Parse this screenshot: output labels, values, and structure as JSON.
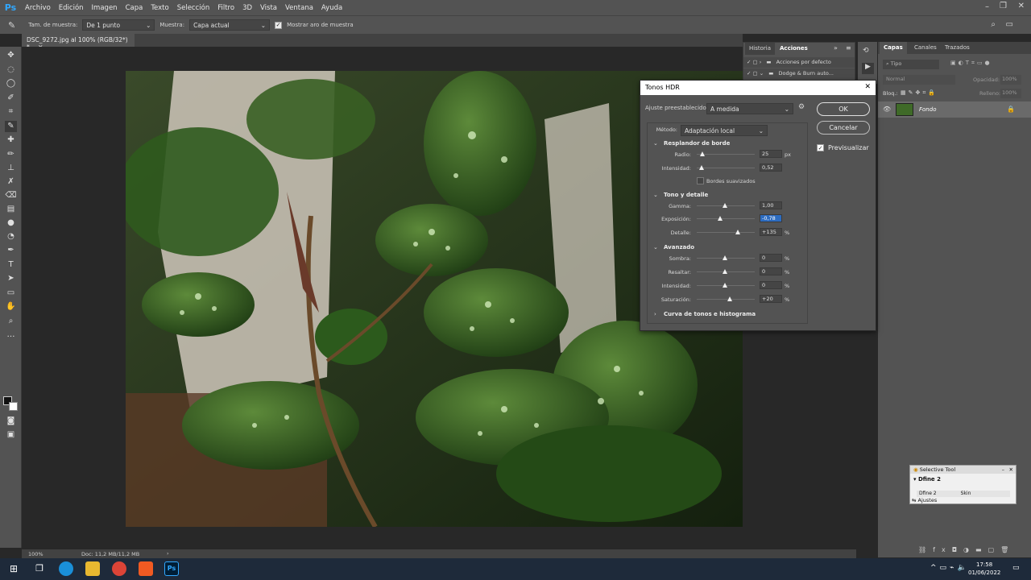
{
  "menubar": {
    "logo": "Ps",
    "items": [
      "Archivo",
      "Edición",
      "Imagen",
      "Capa",
      "Texto",
      "Selección",
      "Filtro",
      "3D",
      "Vista",
      "Ventana",
      "Ayuda"
    ]
  },
  "options": {
    "sample_size_label": "Tam. de muestra:",
    "sample_size_value": "De 1 punto",
    "sample_label": "Muestra:",
    "sample_value": "Capa actual",
    "show_ring_label": "Mostrar aro de muestra"
  },
  "document": {
    "tab_title": "DSC_9272.jpg al 100% (RGB/32*) *",
    "zoom": "100%",
    "doc_info": "Doc: 11,2 MB/11,2 MB"
  },
  "actions_panel": {
    "tabs": [
      "Historia",
      "Acciones"
    ],
    "items": [
      "Acciones por defecto",
      "Dodge & Burn auto..."
    ]
  },
  "layers_panel": {
    "tabs": [
      "Capas",
      "Canales",
      "Trazados"
    ],
    "kind_placeholder": "Tipo",
    "blend_mode": "Normal",
    "opacity_label": "Opacidad:",
    "opacity_value": "100%",
    "lock_label": "Bloq.:",
    "fill_label": "Relleno:",
    "fill_value": "100%",
    "layer_name": "Fondo"
  },
  "hdr_dialog": {
    "title": "Tonos HDR",
    "preset_label": "Ajuste preestablecido:",
    "preset_value": "A medida",
    "method_label": "Método:",
    "method_value": "Adaptación local",
    "ok_label": "OK",
    "cancel_label": "Cancelar",
    "preview_label": "Previsualizar",
    "sections": {
      "edge_glow": "Resplandor de borde",
      "tone_detail": "Tono y detalle",
      "advanced": "Avanzado",
      "curve": "Curva de tonos e histograma"
    },
    "radius_label": "Radio:",
    "radius_value": "25",
    "radius_unit": "px",
    "radius_pos": 0.06,
    "strength_label": "Intensidad:",
    "strength_value": "0,52",
    "strength_pos": 0.05,
    "smooth_edges_label": "Bordes suavizados",
    "gamma_label": "Gamma:",
    "gamma_value": "1,00",
    "gamma_pos": 0.5,
    "exposure_label": "Exposición:",
    "exposure_value": "-0,78",
    "exposure_pos": 0.4,
    "detail_label": "Detalle:",
    "detail_value": "+135",
    "detail_unit": "%",
    "detail_pos": 0.72,
    "shadow_label": "Sombra:",
    "shadow_value": "0",
    "shadow_pos": 0.5,
    "highlight_label": "Resaltar:",
    "highlight_value": "0",
    "highlight_pos": 0.5,
    "vibrance_label": "Intensidad:",
    "vibrance_value": "0",
    "vibrance_pos": 0.5,
    "saturation_label": "Saturación:",
    "saturation_value": "+20",
    "saturation_pos": 0.58,
    "pct": "%"
  },
  "selective_tool": {
    "title": "Selective Tool",
    "plugin": "Dfine 2",
    "row_a": "Dfine 2",
    "row_b": "Skin",
    "adjust": "Ajustes"
  },
  "taskbar": {
    "time": "17:58",
    "date": "01/06/2022"
  }
}
